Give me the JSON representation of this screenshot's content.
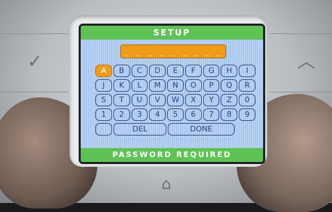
{
  "screen": {
    "title": "SETUP",
    "password_mask": "_ _ _ _ _ _ _ _ _ _ _",
    "status": "PASSWORD REQUIRED"
  },
  "keyboard": {
    "row1": [
      "A",
      "B",
      "C",
      "D",
      "E",
      "F",
      "G",
      "H",
      "I"
    ],
    "row2": [
      "J",
      "K",
      "L",
      "M",
      "N",
      "O",
      "P",
      "Q",
      "R"
    ],
    "row3": [
      "S",
      "T",
      "U",
      "V",
      "W",
      "X",
      "Y",
      "Z",
      "0"
    ],
    "row4": [
      "1",
      "2",
      "3",
      "4",
      "5",
      "6",
      "7",
      "8",
      "9"
    ],
    "delete_label": "DEL",
    "done_label": "DONE",
    "selected_key": "A"
  },
  "device": {
    "left_button_icon": "check-icon",
    "right_button_icon": "up-chevron-icon",
    "home_button_icon": "home-icon"
  },
  "colors": {
    "title_bar": "#5fc255",
    "selected_key": "#f09b1a",
    "screen_bg": "#b9d3f4",
    "key_outline": "#3b4b84"
  }
}
